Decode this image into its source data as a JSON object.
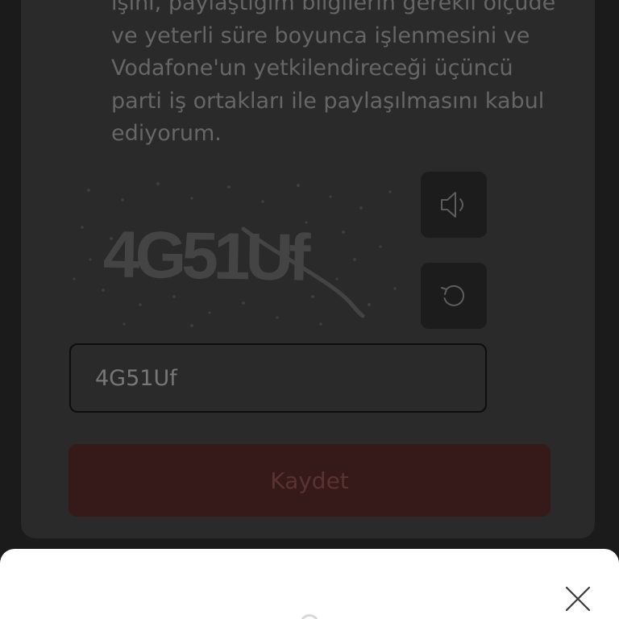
{
  "consent": {
    "lines": [
      "işini, paylaştığım bilgilerin gerekli ölçüde",
      "ve yeterli süre boyunca işlenmesini ve",
      "Vodafone'un yetkilendireceği üçüncü",
      "parti iş ortakları ile paylaşılmasını kabul",
      "ediyorum."
    ]
  },
  "captcha": {
    "image_text": "4G51Uf",
    "audio_icon": "speaker-icon",
    "refresh_icon": "refresh-icon"
  },
  "form": {
    "captcha_value": "4G51Uf"
  },
  "actions": {
    "save_label": "Kaydet"
  },
  "sheet": {
    "close_icon": "close-icon"
  },
  "colors": {
    "brand_red": "#e60000",
    "overlay": "#1b1b1b",
    "sheet_bg": "#ffffff"
  }
}
